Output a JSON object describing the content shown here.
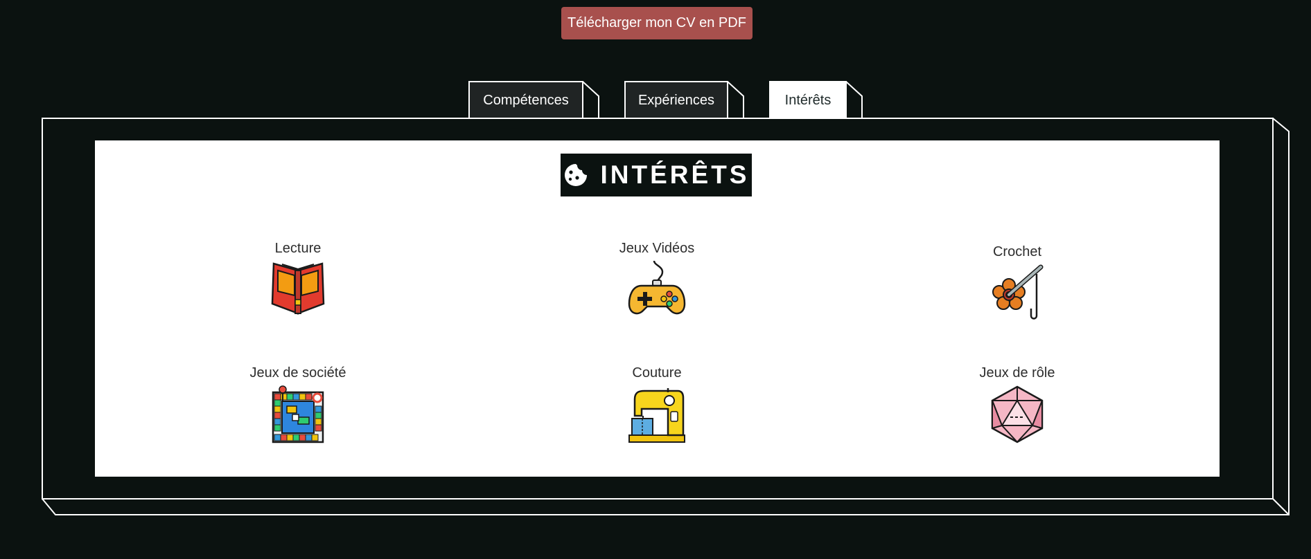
{
  "download_button": {
    "label": "Télécharger mon CV en PDF"
  },
  "tabs": [
    {
      "label": "Compétences",
      "active": false
    },
    {
      "label": "Expériences",
      "active": false
    },
    {
      "label": "Intérêts",
      "active": true
    }
  ],
  "section": {
    "title": "INTÉRÊTS",
    "title_icon": "cookie-icon",
    "interests": [
      {
        "label": "Lecture",
        "icon": "book-icon"
      },
      {
        "label": "Jeux Vidéos",
        "icon": "gamepad-icon"
      },
      {
        "label": "Crochet",
        "icon": "crochet-icon"
      },
      {
        "label": "Jeux de société",
        "icon": "board-game-icon"
      },
      {
        "label": "Couture",
        "icon": "sewing-machine-icon"
      },
      {
        "label": "Jeux de rôle",
        "icon": "d20-dice-icon"
      }
    ]
  },
  "colors": {
    "background": "#0b1210",
    "button": "#a8504d",
    "panel": "#ffffff"
  }
}
